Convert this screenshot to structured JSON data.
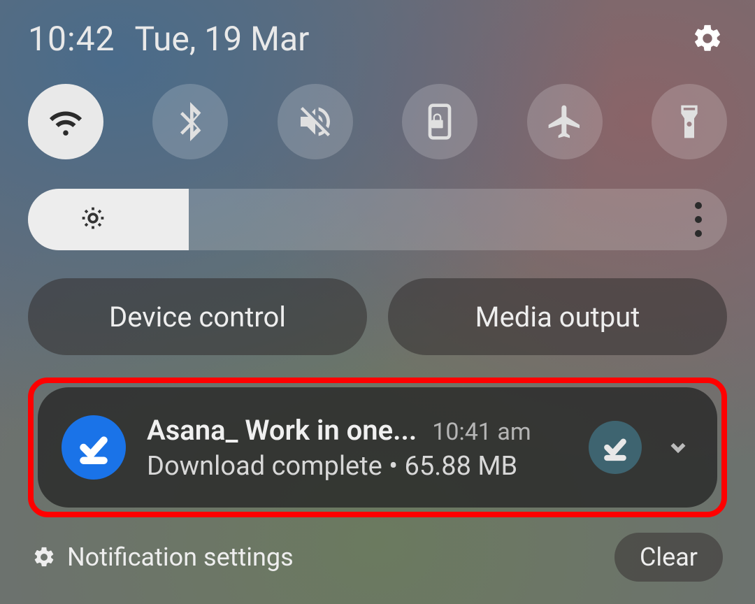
{
  "statusbar": {
    "time": "10:42",
    "date": "Tue, 19 Mar"
  },
  "qs": {
    "tiles": [
      {
        "name": "wifi",
        "active": true
      },
      {
        "name": "bluetooth",
        "active": false
      },
      {
        "name": "mute",
        "active": false
      },
      {
        "name": "rotation-lock",
        "active": false
      },
      {
        "name": "airplane",
        "active": false
      },
      {
        "name": "flashlight",
        "active": false
      }
    ]
  },
  "brightness": {
    "percent": 23
  },
  "pills": {
    "device_control": "Device control",
    "media_output": "Media output"
  },
  "notification": {
    "title": "Asana_ Work in one...",
    "time": "10:41 am",
    "status": "Download complete",
    "size": "65.88 MB"
  },
  "footer": {
    "settings_label": "Notification settings",
    "clear_label": "Clear"
  }
}
